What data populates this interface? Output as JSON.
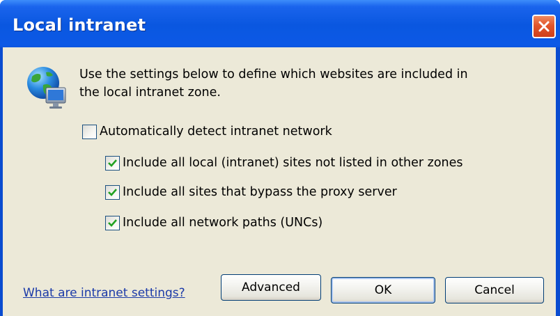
{
  "window": {
    "title": "Local intranet",
    "close_icon": "close-icon"
  },
  "content": {
    "icon": "network-globe-monitor-icon",
    "description_line1": "Use the settings below to define which websites are included in",
    "description_line2": "the local intranet zone."
  },
  "options": [
    {
      "label": "Automatically detect intranet network",
      "checked": false
    },
    {
      "label": "Include all local (intranet) sites not listed in other zones",
      "checked": true
    },
    {
      "label": "Include all sites that bypass the proxy server",
      "checked": true
    },
    {
      "label": "Include all network paths (UNCs)",
      "checked": true
    }
  ],
  "footer": {
    "help_link": "What are intranet settings?",
    "advanced_label": "Advanced",
    "ok_label": "OK",
    "cancel_label": "Cancel"
  },
  "colors": {
    "titlebar": "#0a57e0",
    "dialog_bg": "#ece9d8",
    "checkmark": "#21a121",
    "link": "#1b3aa8"
  }
}
